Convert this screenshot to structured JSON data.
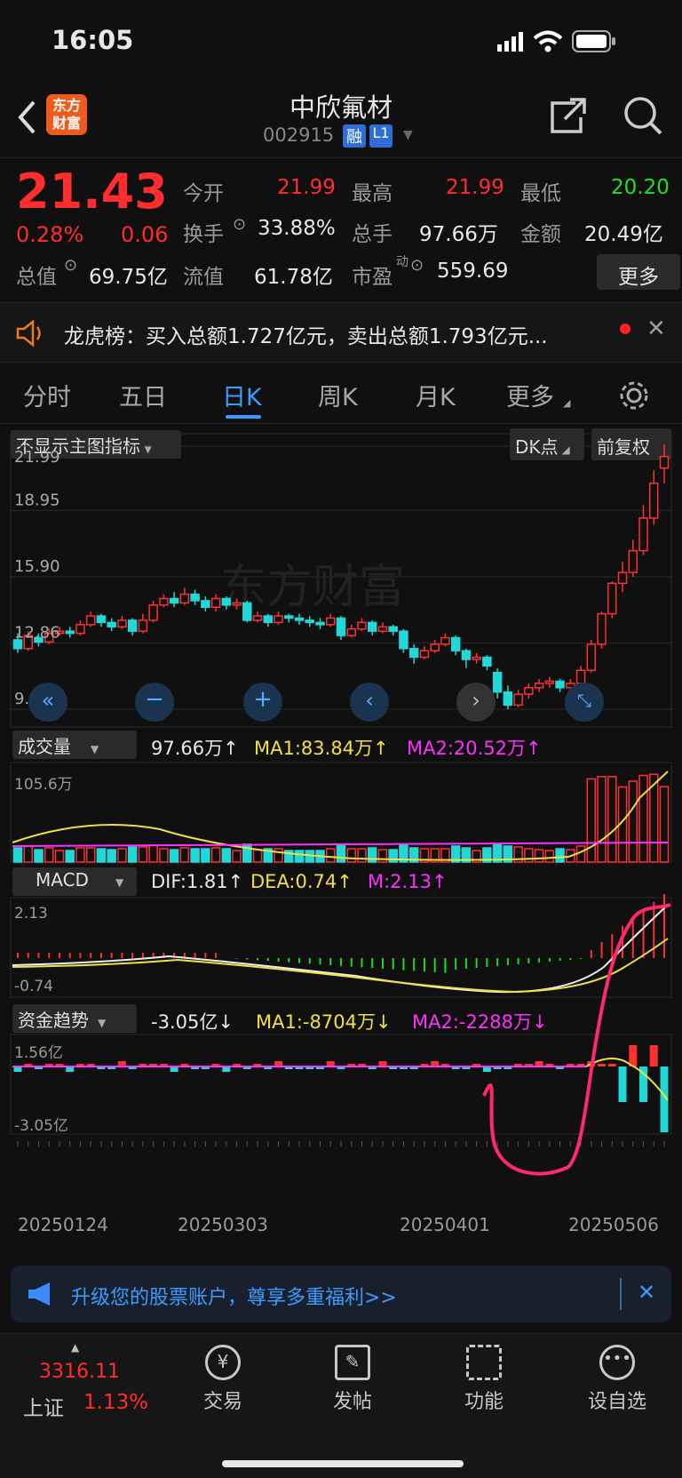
{
  "status": {
    "time": "16:05"
  },
  "header": {
    "logo": "东方\n财富",
    "logo_line1": "东方",
    "logo_line2": "财富",
    "title": "中欣氟材",
    "code": "002915",
    "badge_margin": "融",
    "badge_level": "L1"
  },
  "quote": {
    "price": "21.43",
    "change_pct": "0.28%",
    "change": "0.06",
    "open_label": "今开",
    "open": "21.99",
    "high_label": "最高",
    "high": "21.99",
    "low_label": "最低",
    "low": "20.20",
    "turnover_label": "换手",
    "turnover": "33.88%",
    "volume_label": "总手",
    "volume": "97.66万",
    "amount_label": "金额",
    "amount": "20.49亿",
    "mktcap_label": "总值",
    "mktcap": "69.75亿",
    "float_label": "流值",
    "float_cap": "61.78亿",
    "pe_label": "市盈",
    "pe_sup": "动",
    "pe": "559.69",
    "more": "更多"
  },
  "notice": {
    "text": "龙虎榜：买入总额1.727亿元，卖出总额1.793亿元..."
  },
  "tabs": [
    "分时",
    "五日",
    "日K",
    "周K",
    "月K",
    "更多"
  ],
  "chart": {
    "indicator_select": "不显示主图指标",
    "dk": "DK点",
    "adjust": "前复权",
    "watermark": "东方财富",
    "price_ticks": [
      "21.99",
      "18.95",
      "15.90",
      "12.86",
      "9.81"
    ],
    "volume": {
      "select": "成交量",
      "value": "97.66万↑",
      "ma1": "MA1:83.84万↑",
      "ma2": "MA2:20.52万↑",
      "top": "105.6万"
    },
    "macd": {
      "select": "MACD",
      "dif": "DIF:1.81↑",
      "dea": "DEA:0.74↑",
      "m": "M:2.13↑",
      "top": "2.13",
      "bottom": "-0.74"
    },
    "fund": {
      "select": "资金趋势",
      "value": "-3.05亿↓",
      "ma1": "MA1:-8704万↓",
      "ma2": "MA2:-2288万↓",
      "top": "1.56亿",
      "bottom": "-3.05亿"
    },
    "dates": [
      "20250124",
      "20250303",
      "20250401",
      "20250506"
    ]
  },
  "chart_data": {
    "type": "candlestick",
    "price_axis": [
      9.81,
      21.99
    ],
    "candles": [
      [
        13.0,
        12.6,
        13.3,
        12.4
      ],
      [
        12.6,
        13.2,
        13.4,
        12.5
      ],
      [
        13.1,
        12.9,
        13.3,
        12.7
      ],
      [
        12.9,
        13.3,
        13.5,
        12.8
      ],
      [
        13.3,
        13.4,
        13.6,
        13.2
      ],
      [
        13.4,
        13.3,
        13.6,
        13.1
      ],
      [
        13.3,
        13.7,
        13.9,
        13.2
      ],
      [
        13.7,
        14.1,
        14.3,
        13.6
      ],
      [
        14.1,
        13.8,
        14.2,
        13.6
      ],
      [
        13.8,
        13.6,
        14.0,
        13.4
      ],
      [
        13.6,
        13.9,
        14.1,
        13.5
      ],
      [
        13.9,
        13.4,
        14.0,
        13.2
      ],
      [
        13.4,
        13.9,
        14.2,
        13.3
      ],
      [
        13.9,
        14.6,
        14.8,
        13.8
      ],
      [
        14.6,
        14.9,
        15.1,
        14.5
      ],
      [
        14.9,
        14.7,
        15.2,
        14.5
      ],
      [
        14.7,
        15.1,
        15.4,
        14.6
      ],
      [
        15.1,
        14.8,
        15.3,
        14.6
      ],
      [
        14.8,
        14.5,
        15.0,
        14.3
      ],
      [
        14.5,
        14.9,
        15.1,
        14.3
      ],
      [
        14.9,
        14.6,
        15.0,
        14.4
      ],
      [
        14.6,
        14.7,
        14.9,
        14.4
      ],
      [
        14.7,
        13.9,
        14.8,
        13.8
      ],
      [
        13.9,
        14.1,
        14.3,
        13.8
      ],
      [
        14.1,
        13.8,
        14.2,
        13.6
      ],
      [
        13.8,
        14.1,
        14.3,
        13.7
      ],
      [
        14.1,
        14.0,
        14.2,
        13.8
      ],
      [
        14.0,
        13.9,
        14.2,
        13.7
      ],
      [
        13.9,
        13.8,
        14.1,
        13.6
      ],
      [
        13.8,
        13.7,
        14.0,
        13.5
      ],
      [
        13.7,
        14.0,
        14.2,
        13.6
      ],
      [
        14.0,
        13.2,
        14.1,
        13.0
      ],
      [
        13.2,
        13.5,
        13.7,
        13.1
      ],
      [
        13.5,
        13.8,
        14.0,
        13.4
      ],
      [
        13.8,
        13.4,
        13.9,
        13.2
      ],
      [
        13.4,
        13.6,
        13.8,
        13.3
      ],
      [
        13.6,
        13.4,
        13.7,
        13.2
      ],
      [
        13.4,
        12.6,
        13.5,
        12.4
      ],
      [
        12.6,
        12.2,
        12.8,
        11.9
      ],
      [
        12.2,
        12.5,
        12.7,
        12.1
      ],
      [
        12.5,
        12.8,
        13.0,
        12.4
      ],
      [
        12.8,
        13.1,
        13.3,
        12.7
      ],
      [
        13.1,
        12.5,
        13.2,
        12.3
      ],
      [
        12.5,
        12.1,
        12.6,
        11.7
      ],
      [
        12.1,
        12.2,
        12.4,
        11.9
      ],
      [
        12.2,
        11.8,
        12.3,
        11.6
      ],
      [
        11.5,
        10.6,
        11.7,
        10.3
      ],
      [
        10.6,
        10.0,
        10.9,
        9.81
      ],
      [
        10.0,
        10.5,
        10.7,
        9.9
      ],
      [
        10.5,
        10.8,
        11.0,
        10.3
      ],
      [
        10.8,
        11.0,
        11.2,
        10.6
      ],
      [
        11.0,
        11.1,
        11.3,
        10.8
      ],
      [
        11.1,
        10.8,
        11.2,
        10.6
      ],
      [
        10.8,
        11.0,
        11.2,
        10.6
      ],
      [
        11.0,
        11.6,
        11.8,
        10.9
      ],
      [
        11.6,
        12.8,
        13.0,
        11.5
      ],
      [
        12.8,
        14.2,
        14.3,
        12.6
      ],
      [
        14.2,
        15.6,
        15.7,
        14.0
      ],
      [
        15.6,
        16.1,
        16.6,
        15.2
      ],
      [
        16.1,
        17.1,
        17.6,
        15.9
      ],
      [
        17.1,
        18.6,
        19.2,
        16.9
      ],
      [
        18.6,
        20.2,
        20.8,
        18.3
      ],
      [
        20.9,
        21.43,
        21.99,
        20.2
      ]
    ],
    "volume_ma": [
      83.84,
      20.52
    ],
    "fund_trend": [
      -3.05,
      -8704,
      -2288
    ]
  }
}
